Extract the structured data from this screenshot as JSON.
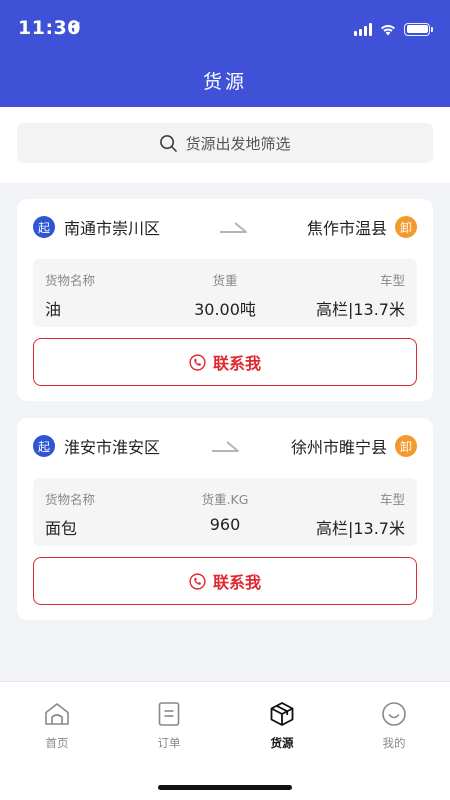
{
  "status_bar": {
    "time": "11:30"
  },
  "nav": {
    "title": "货源"
  },
  "search": {
    "placeholder": "货源出发地筛选"
  },
  "badges": {
    "start": "起",
    "end": "卸"
  },
  "cards": [
    {
      "origin": "南通市崇川区",
      "destination": "焦作市温县",
      "goods_label": "货物名称",
      "goods_value": "油",
      "weight_label": "货重",
      "weight_value": "30.00吨",
      "vehicle_label": "车型",
      "vehicle_value": "高栏|13.7米",
      "contact_label": "联系我"
    },
    {
      "origin": "淮安市淮安区",
      "destination": "徐州市睢宁县",
      "goods_label": "货物名称",
      "goods_value": "面包",
      "weight_label": "货重.KG",
      "weight_value": "960",
      "vehicle_label": "车型",
      "vehicle_value": "高栏|13.7米",
      "contact_label": "联系我"
    }
  ],
  "tabbar": {
    "items": [
      {
        "label": "首页",
        "icon": "home-icon",
        "active": false
      },
      {
        "label": "订单",
        "icon": "order-icon",
        "active": false
      },
      {
        "label": "货源",
        "icon": "cargo-box-icon",
        "active": true
      },
      {
        "label": "我的",
        "icon": "profile-smile-icon",
        "active": false
      }
    ]
  },
  "colors": {
    "header": "#3f51d6",
    "start_badge": "#2f55d4",
    "end_badge": "#f29a2e",
    "contact": "#e0292f"
  }
}
